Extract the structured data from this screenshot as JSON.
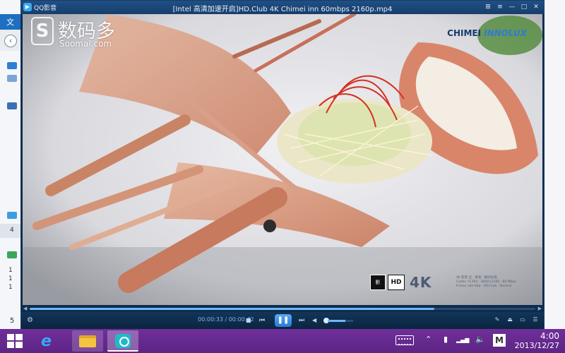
{
  "explorer": {
    "ribbon_tab": "文",
    "side_numbers": [
      "1",
      "1",
      "1"
    ],
    "selected_label": "4",
    "bottom_count": "5"
  },
  "player": {
    "app_name": "QQ影音",
    "video_title": "[Intel 高清加速开启]HD.Club 4K Chimei inn 60mbps 2160p.mp4",
    "window_buttons": [
      "⊞",
      "≡",
      "—",
      "□",
      "✕"
    ],
    "watermark": {
      "logo_glyph": "S",
      "text_cn": "数码多",
      "text_en": "Soomal.com"
    },
    "brand": {
      "part1": "CHIMEI",
      "part2": "INNOLUX"
    },
    "badge": {
      "box1": "影",
      "box2": "HD",
      "box2_sub": "CLUB",
      "k4": "4K"
    },
    "credits": [
      "4K 影音 全 · 奇美 · 群创光电",
      "Codec: H.264 · 3840×2160 · 60 Mbps",
      "Frame rate 60p · HD.Club · Soomal"
    ],
    "progress": {
      "fraction": 0.8
    },
    "time": {
      "current": "00:00:33",
      "total": "00:00:42",
      "separator": " / "
    },
    "volume": {
      "fraction": 0.7
    },
    "controls": {
      "stop": "■",
      "prev": "⏮",
      "play_pause": "❚❚",
      "next": "⏭",
      "volume": "◀"
    },
    "right_tools": [
      "✎",
      "⏏",
      "▭",
      "☰"
    ]
  },
  "taskbar": {
    "ie_glyph": "e",
    "tray": {
      "chevron": "⌃",
      "battery": "▮",
      "network": "▂▄▆",
      "sound": "🔈",
      "ime": "M"
    },
    "clock": {
      "time": "4:00",
      "date": "2013/12/27"
    }
  }
}
